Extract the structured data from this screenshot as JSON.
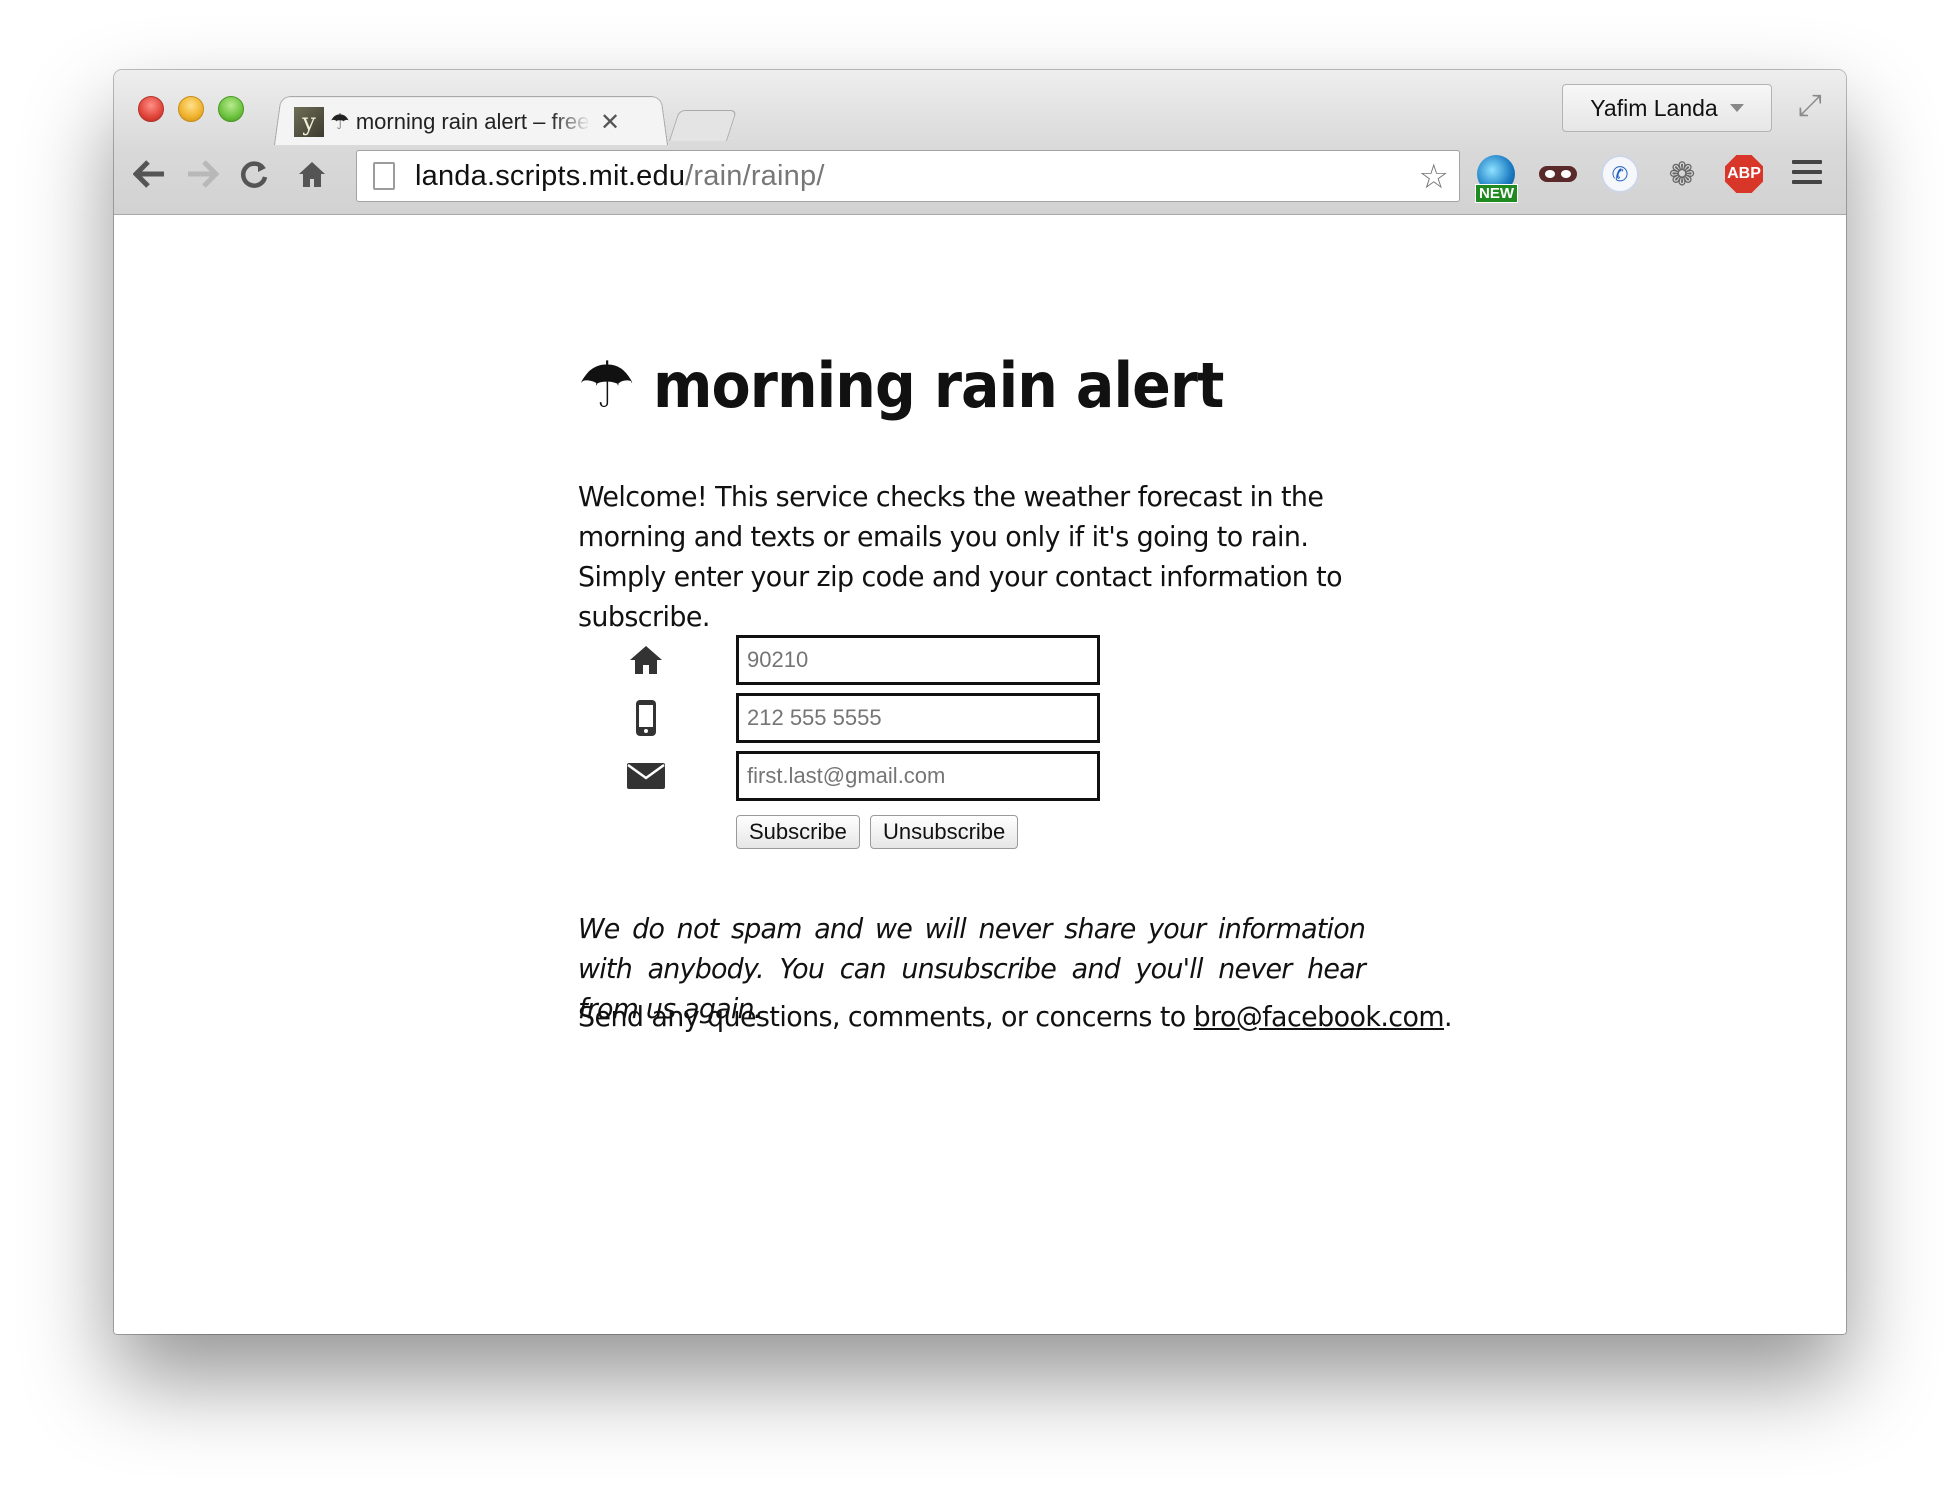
{
  "browser": {
    "tab": {
      "favicon_letter": "y",
      "title": "☂ morning rain alert – free",
      "close_glyph": "✕"
    },
    "profile": {
      "name": "Yafim Landa"
    },
    "url": {
      "host": "landa.scripts.mit.edu",
      "path": "/rain/rainp/"
    },
    "extensions": {
      "new_badge": "NEW",
      "abp_label": "ABP"
    }
  },
  "page": {
    "umbrella_glyph": "☂",
    "title": "morning rain alert",
    "intro": {
      "part1": "Welcome! This service checks the weather forecast in the morning and texts or emails you ",
      "emphasis": "only",
      "part2": " if it's going to rain. Simply enter your zip code and your contact information to subscribe."
    },
    "form": {
      "zip_placeholder": "90210",
      "phone_placeholder": "212 555 5555",
      "email_placeholder": "first.last@gmail.com",
      "subscribe_label": "Subscribe",
      "unsubscribe_label": "Unsubscribe"
    },
    "disclaimer": "We do not spam and we will never share your information with anybody. You can unsubscribe and you'll never hear from us again.",
    "contact": {
      "prefix": "Send any questions, comments, or concerns to ",
      "email": "bro@facebook.com",
      "suffix": "."
    }
  },
  "icons": {
    "zip": "home-icon",
    "phone": "mobile-phone-icon",
    "email": "envelope-icon"
  }
}
